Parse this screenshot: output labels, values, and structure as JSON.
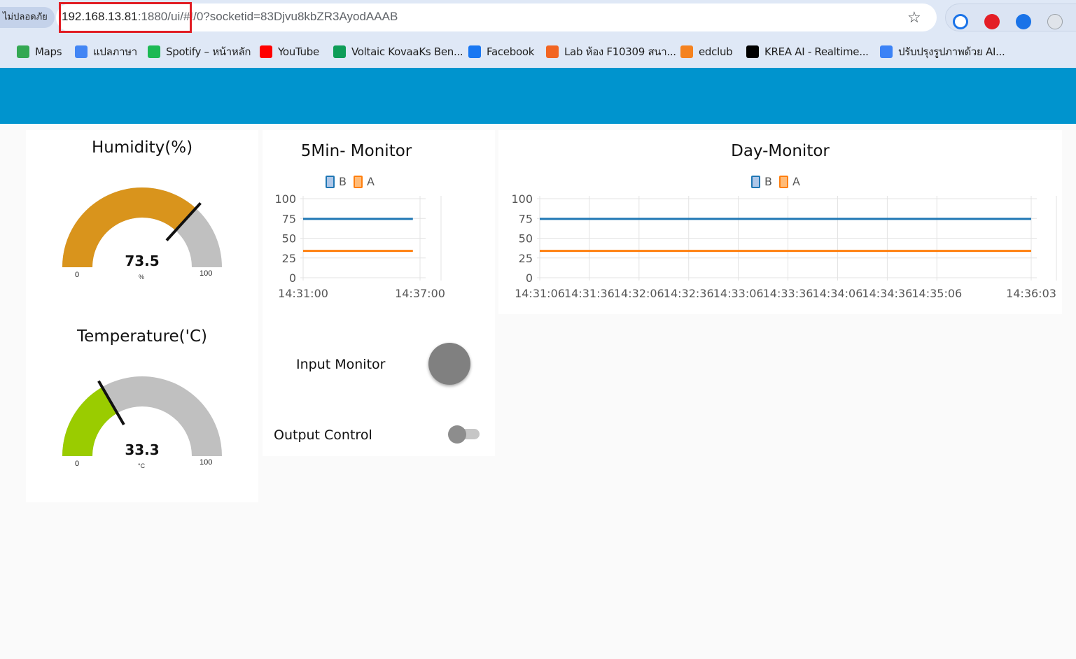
{
  "browser": {
    "security_label": "ไม่ปลอดภัย",
    "url_host": "192.168.13.81",
    "url_rest": ":1880/ui/#!/0?socketid=83Djvu8kbZR3AyodAAAB"
  },
  "bookmarks": [
    {
      "label": "Maps",
      "icon": "maps-icon",
      "color": "#34a853"
    },
    {
      "label": "แปลภาษา",
      "icon": "translate-icon",
      "color": "#4285f4"
    },
    {
      "label": "Spotify – หน้าหลัก",
      "icon": "spotify-icon",
      "color": "#1db954"
    },
    {
      "label": "YouTube",
      "icon": "youtube-icon",
      "color": "#ff0000"
    },
    {
      "label": "Voltaic KovaaKs Ben...",
      "icon": "sheets-icon",
      "color": "#0f9d58"
    },
    {
      "label": "Facebook",
      "icon": "facebook-icon",
      "color": "#1877f2"
    },
    {
      "label": "Lab ห้อง F10309 สนา...",
      "icon": "sut-icon",
      "color": "#f26522"
    },
    {
      "label": "edclub",
      "icon": "edclub-icon",
      "color": "#f5821f"
    },
    {
      "label": "KREA AI - Realtime...",
      "icon": "krea-icon",
      "color": "#000000"
    },
    {
      "label": "ปรับปรุงรูปภาพด้วย AI...",
      "icon": "sharpen-icon",
      "color": "#3b82f6"
    }
  ],
  "colors": {
    "toolbar": "#0094ce",
    "humidity_fill": "#d9941c",
    "temperature_fill": "#9acc00",
    "gauge_track": "#c0c0c0",
    "series_b": "#1f77b4",
    "series_a": "#ff7f0e"
  },
  "humidity": {
    "title": "Humidity(%)",
    "value": "73.5",
    "unit": "%",
    "min": "0",
    "max": "100",
    "level": 0.735
  },
  "temperature": {
    "title": "Temperature('C)",
    "value": "33.3",
    "unit": "°C",
    "min": "0",
    "max": "100",
    "level": 0.333
  },
  "controls": {
    "input_label": "Input Monitor",
    "output_label": "Output Control",
    "led_state": "off",
    "switch_state": "off"
  },
  "chart_data": [
    {
      "type": "line",
      "title": "5Min- Monitor",
      "legend": [
        "B",
        "A"
      ],
      "ylim": [
        0,
        100
      ],
      "yticks": [
        "100",
        "75",
        "50",
        "25",
        "0"
      ],
      "xticks": [
        "14:31:00",
        "14:37:00"
      ],
      "xlim_seconds": [
        0,
        360
      ],
      "series": [
        {
          "name": "B",
          "x_seconds": [
            0,
            338
          ],
          "values": [
            74.5,
            74.5
          ]
        },
        {
          "name": "A",
          "x_seconds": [
            0,
            338
          ],
          "values": [
            34,
            34
          ]
        }
      ]
    },
    {
      "type": "line",
      "title": "Day-Monitor",
      "legend": [
        "B",
        "A"
      ],
      "ylim": [
        0,
        100
      ],
      "yticks": [
        "100",
        "75",
        "50",
        "25",
        "0"
      ],
      "xticks": [
        "14:31:06",
        "14:31:36",
        "14:32:06",
        "14:32:36",
        "14:33:06",
        "14:33:36",
        "14:34:06",
        "14:34:36",
        "14:35:06",
        "14:36:03"
      ],
      "xtick_seconds": [
        0,
        30,
        60,
        90,
        120,
        150,
        180,
        210,
        240,
        297
      ],
      "xlim_seconds": [
        0,
        297
      ],
      "series": [
        {
          "name": "B",
          "x_seconds": [
            0,
            297
          ],
          "values": [
            74.5,
            74.5
          ]
        },
        {
          "name": "A",
          "x_seconds": [
            0,
            297
          ],
          "values": [
            34,
            34
          ]
        }
      ]
    }
  ]
}
